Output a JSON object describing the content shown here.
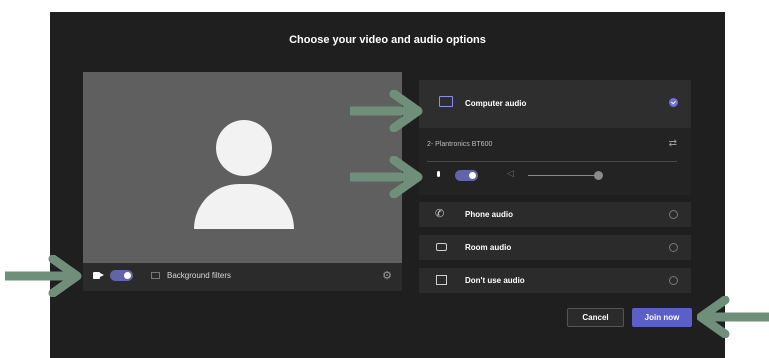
{
  "dialog": {
    "title": "Choose your video and audio options"
  },
  "camera": {
    "background_filters_label": "Background filters",
    "camera_on": true
  },
  "audio": {
    "options": [
      {
        "label": "Computer audio",
        "selected": true
      },
      {
        "label": "Phone audio",
        "selected": false
      },
      {
        "label": "Room audio",
        "selected": false
      },
      {
        "label": "Don't use audio",
        "selected": false
      }
    ],
    "device_name": "2- Plantronics BT600",
    "mic_on": true
  },
  "buttons": {
    "cancel": "Cancel",
    "join": "Join now"
  },
  "colors": {
    "dialog_bg": "#1f1f1f",
    "accent": "#5b5fc7",
    "arrow": "#6f8f7a"
  },
  "icons": {
    "camera": "camera-icon",
    "background": "background-filter-icon",
    "settings": "gear-icon",
    "computer_audio": "monitor-speaker-icon",
    "phone_audio": "phone-icon",
    "room_audio": "room-device-icon",
    "no_audio": "no-audio-icon",
    "device_settings": "sliders-icon",
    "mic": "microphone-icon",
    "speaker": "speaker-icon"
  }
}
